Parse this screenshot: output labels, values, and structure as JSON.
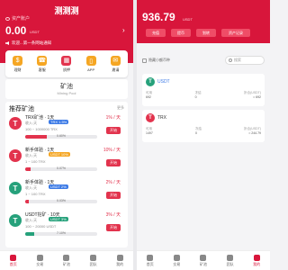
{
  "left": {
    "app_title": "测测测",
    "account_label": "资产账户",
    "balance": "0.00",
    "balance_unit": "USDT",
    "notice": "欢迎...第一条网站通知",
    "menu": [
      {
        "label": "理财",
        "icon": "dollar-icon",
        "color": "#f5a623"
      },
      {
        "label": "客服",
        "icon": "headset-icon",
        "color": "#f5a623"
      },
      {
        "label": "质押",
        "icon": "vault-icon",
        "color": "#e2334d"
      },
      {
        "label": "APP",
        "icon": "phone-icon",
        "color": "#f5a623"
      },
      {
        "label": "邀请",
        "icon": "gift-icon",
        "color": "#f5a623"
      }
    ],
    "pool_banner": {
      "title": "矿池",
      "subtitle": "Mining Pool"
    },
    "section": {
      "title": "推荐矿池",
      "more": "更多"
    },
    "pools": [
      {
        "name": "TRX矿池 · 1天",
        "badge": "TRX 1.5%",
        "tag": "收入:天",
        "range": "100 ~ 1000000 TRX",
        "pct": "1% / 天",
        "progress": 0.6,
        "progress_label": "0.60%",
        "button": "开始",
        "icon": "T",
        "color": "#e2334d"
      },
      {
        "name": "新手体验 · 1天",
        "badge": "USDT 10%",
        "tag": "收入:天",
        "range": "1 ~ 100 TRX",
        "pct": "10% / 天",
        "progress": 0.07,
        "progress_label": "0.07%",
        "button": "开始",
        "icon": "T",
        "color": "#e2334d"
      },
      {
        "name": "新手体验 · 1天",
        "badge": "USDT 2%",
        "tag": "收入:天",
        "range": "1 ~ 100 TRX",
        "pct": "2% / 天",
        "progress": 0.03,
        "progress_label": "0.03%",
        "button": "开始",
        "icon": "T",
        "color": "#26a17b"
      },
      {
        "name": "USDT挖矿 · 10天",
        "badge": "USDT 3%",
        "tag": "收入:天",
        "range": "100 ~ 20000 USDT",
        "pct": "3% / 天",
        "progress": 0.12,
        "progress_label": "7.10%",
        "button": "开始",
        "icon": "T",
        "color": "#26a17b"
      }
    ],
    "tabs": [
      {
        "label": "首页",
        "active": true
      },
      {
        "label": "交易",
        "active": false
      },
      {
        "label": "矿池",
        "active": false
      },
      {
        "label": "团队",
        "active": false
      },
      {
        "label": "我的",
        "active": false
      }
    ]
  },
  "right": {
    "balance": "936.79",
    "balance_unit": "USDT",
    "buttons": [
      "充值",
      "提币",
      "划转",
      "资产记录"
    ],
    "hide_zero_label": "隐藏小额币种",
    "search_placeholder": "搜索",
    "assets": [
      {
        "name": "USDT",
        "icon": "T",
        "color": "#26a17b",
        "cols": [
          {
            "k": "可用",
            "v": "692"
          },
          {
            "k": "冻结",
            "v": "0"
          },
          {
            "k": "折合(USDT)",
            "v": "≈ 692"
          }
        ]
      },
      {
        "name": "TRX",
        "icon": "T",
        "color": "#e2334d",
        "cols": [
          {
            "k": "可用",
            "v": "1497"
          },
          {
            "k": "冻结",
            "v": "0"
          },
          {
            "k": "折合(USDT)",
            "v": "≈ 244.79"
          }
        ]
      }
    ],
    "tabs": [
      {
        "label": "首页",
        "active": false
      },
      {
        "label": "交易",
        "active": false
      },
      {
        "label": "矿池",
        "active": false
      },
      {
        "label": "团队",
        "active": false
      },
      {
        "label": "我的",
        "active": true
      }
    ]
  }
}
